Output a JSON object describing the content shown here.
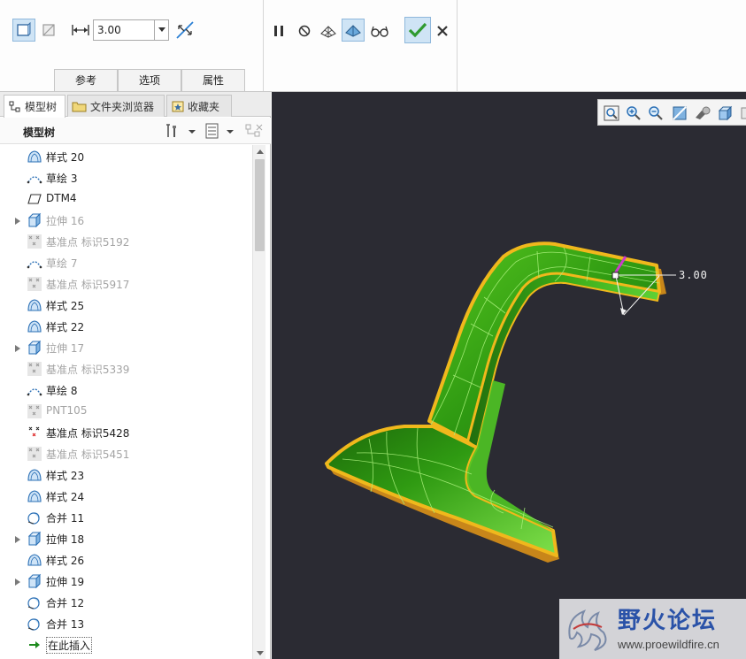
{
  "dashboard": {
    "thickness_value": "3.00",
    "slide_tabs": [
      "参考",
      "选项",
      "属性"
    ]
  },
  "navigator": {
    "tabs": [
      "模型树",
      "文件夹浏览器",
      "收藏夹"
    ],
    "tree_title": "模型树",
    "items": [
      {
        "label": "样式 20",
        "icon": "style-icon",
        "dim": false,
        "expandable": false
      },
      {
        "label": "草绘 3",
        "icon": "sketch-icon",
        "dim": false,
        "expandable": false
      },
      {
        "label": "DTM4",
        "icon": "datum-plane-icon",
        "dim": false,
        "expandable": false
      },
      {
        "label": "拉伸 16",
        "icon": "extrude-icon",
        "dim": true,
        "expandable": true
      },
      {
        "label": "基准点 标识5192",
        "icon": "datum-point-icon",
        "dim": true,
        "expandable": false
      },
      {
        "label": "草绘 7",
        "icon": "sketch-icon",
        "dim": true,
        "expandable": false
      },
      {
        "label": "基准点 标识5917",
        "icon": "datum-point-icon",
        "dim": true,
        "expandable": false
      },
      {
        "label": "样式 25",
        "icon": "style-icon",
        "dim": false,
        "expandable": false
      },
      {
        "label": "样式 22",
        "icon": "style-icon",
        "dim": false,
        "expandable": false
      },
      {
        "label": "拉伸 17",
        "icon": "extrude-icon",
        "dim": true,
        "expandable": true
      },
      {
        "label": "基准点 标识5339",
        "icon": "datum-point-icon",
        "dim": true,
        "expandable": false
      },
      {
        "label": "草绘 8",
        "icon": "sketch-icon",
        "dim": false,
        "expandable": false
      },
      {
        "label": "PNT105",
        "icon": "datum-point-icon",
        "dim": true,
        "expandable": false
      },
      {
        "label": "基准点 标识5428",
        "icon": "datum-point-active-icon",
        "dim": false,
        "expandable": false
      },
      {
        "label": "基准点 标识5451",
        "icon": "datum-point-icon",
        "dim": true,
        "expandable": false
      },
      {
        "label": "样式 23",
        "icon": "style-icon",
        "dim": false,
        "expandable": false
      },
      {
        "label": "样式 24",
        "icon": "style-icon",
        "dim": false,
        "expandable": false
      },
      {
        "label": "合并 11",
        "icon": "merge-icon",
        "dim": false,
        "expandable": false
      },
      {
        "label": "拉伸 18",
        "icon": "extrude-icon",
        "dim": false,
        "expandable": true
      },
      {
        "label": "样式 26",
        "icon": "style-icon",
        "dim": false,
        "expandable": false
      },
      {
        "label": "拉伸 19",
        "icon": "extrude-icon",
        "dim": false,
        "expandable": true
      },
      {
        "label": "合并 12",
        "icon": "merge-icon",
        "dim": false,
        "expandable": false
      },
      {
        "label": "合并 13",
        "icon": "merge-icon",
        "dim": false,
        "expandable": false
      },
      {
        "label": "在此插入",
        "icon": "insert-here-icon",
        "dim": false,
        "expandable": false,
        "insert": true
      }
    ]
  },
  "graphics": {
    "dimension_value": "3.00"
  },
  "watermark": {
    "name": "野火论坛",
    "url": "www.proewildfire.cn"
  },
  "colors": {
    "accent": "#2a7fd4",
    "ok_green": "#2f9a2f",
    "part_green": "#2f9a12",
    "part_edge": "#f0b81c",
    "viewport_bg": "#2b2b33"
  }
}
